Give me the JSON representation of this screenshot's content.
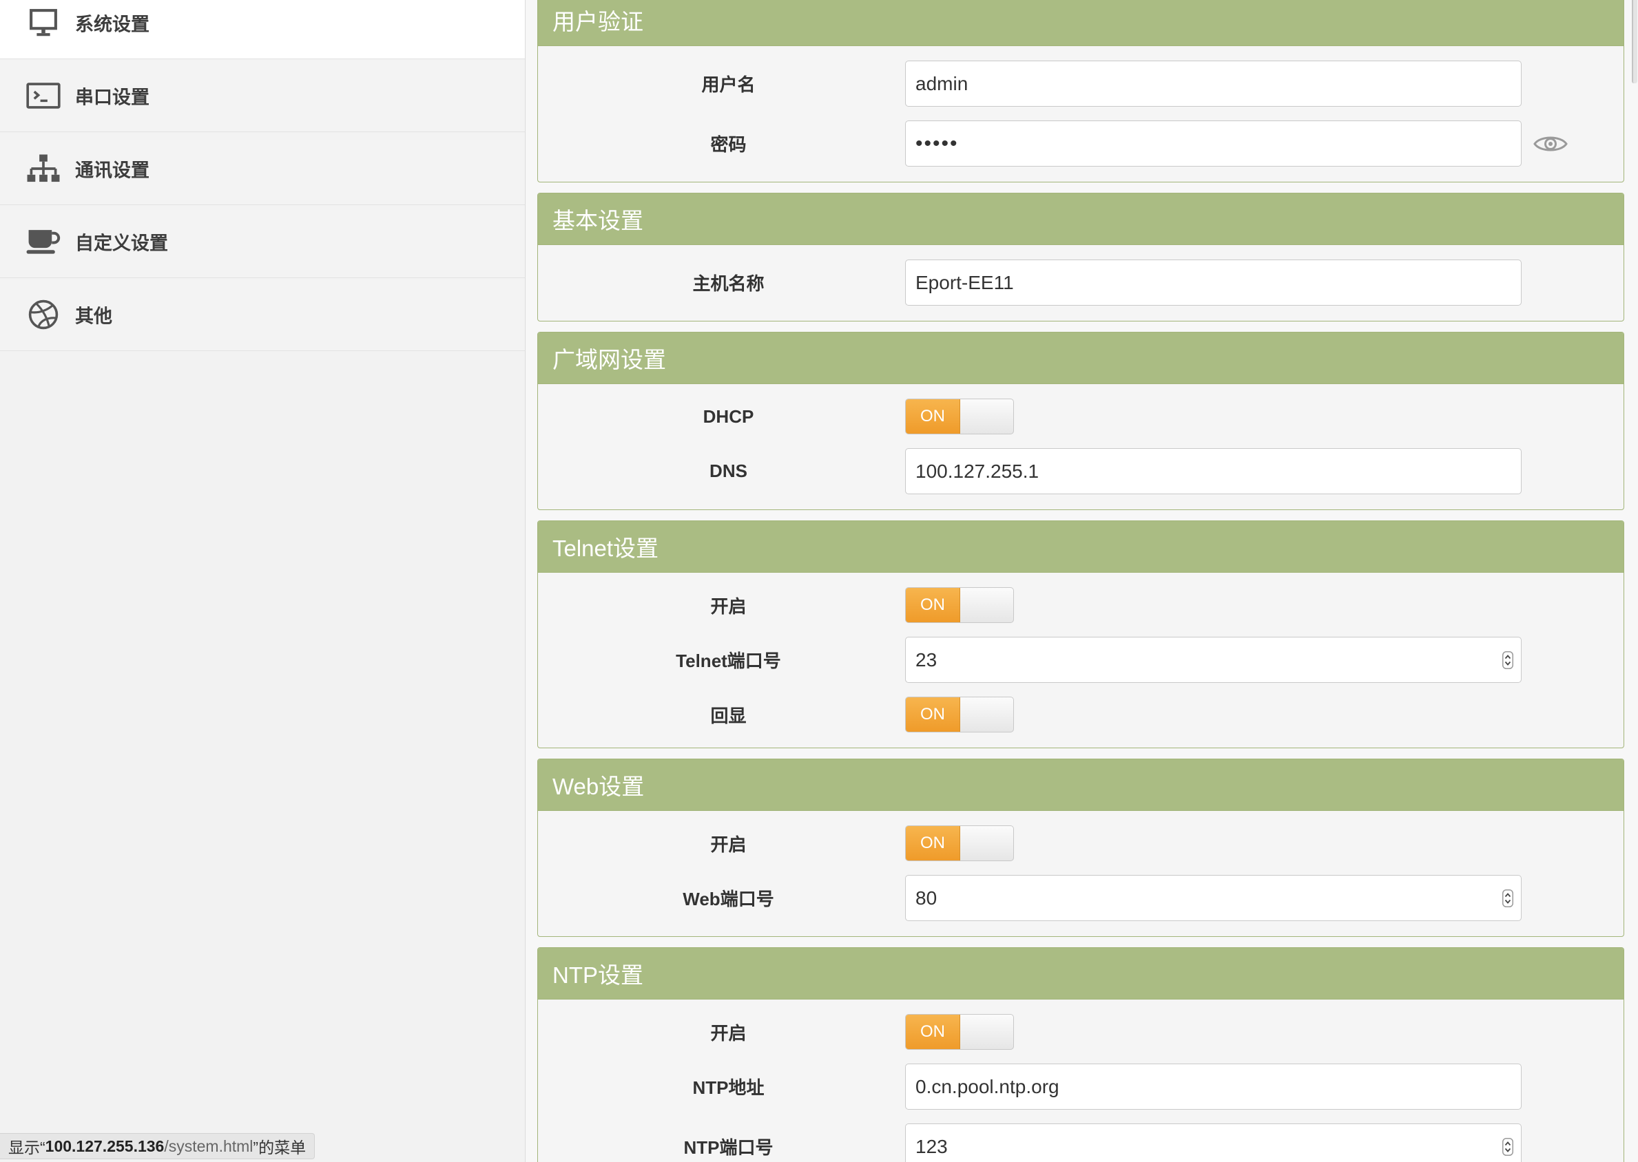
{
  "sidebar": {
    "active_index": 0,
    "items": [
      {
        "label": "系统设置",
        "icon": "monitor-icon"
      },
      {
        "label": "串口设置",
        "icon": "terminal-icon"
      },
      {
        "label": "通讯设置",
        "icon": "sitemap-icon"
      },
      {
        "label": "自定义设置",
        "icon": "coffee-cup-icon"
      },
      {
        "label": "其他",
        "icon": "dribbble-icon"
      }
    ]
  },
  "sections": {
    "auth": {
      "title": "用户验证",
      "username": {
        "label": "用户名",
        "value": "admin"
      },
      "password": {
        "label": "密码",
        "value": "•••••",
        "reveal_icon": "eye-icon"
      }
    },
    "basic": {
      "title": "基本设置",
      "hostname": {
        "label": "主机名称",
        "value": "Eport-EE11"
      }
    },
    "wan": {
      "title": "广域网设置",
      "dhcp": {
        "label": "DHCP",
        "state": "ON"
      },
      "dns": {
        "label": "DNS",
        "value": "100.127.255.1"
      }
    },
    "telnet": {
      "title": "Telnet设置",
      "enable": {
        "label": "开启",
        "state": "ON"
      },
      "port": {
        "label": "Telnet端口号",
        "value": "23"
      },
      "echo": {
        "label": "回显",
        "state": "ON"
      }
    },
    "web": {
      "title": "Web设置",
      "enable": {
        "label": "开启",
        "state": "ON"
      },
      "port": {
        "label": "Web端口号",
        "value": "80"
      }
    },
    "ntp": {
      "title": "NTP设置",
      "enable": {
        "label": "开启",
        "state": "ON"
      },
      "server": {
        "label": "NTP地址",
        "value": "0.cn.pool.ntp.org"
      },
      "port": {
        "label": "NTP端口号",
        "value": "123"
      }
    }
  },
  "status_bar": {
    "prefix": "显示“",
    "host": "100.127.255.136",
    "path": "/system.html",
    "suffix": "”的菜单"
  },
  "colors": {
    "panel_header": "#aabc83",
    "toggle_on": "#ef9b2a",
    "sidebar_bg": "#f3f3f3"
  }
}
